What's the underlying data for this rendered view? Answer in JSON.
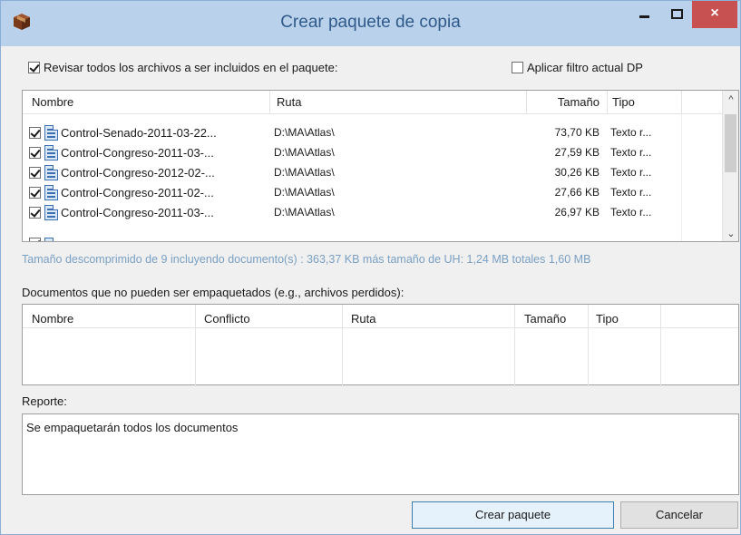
{
  "window": {
    "title": "Crear paquete de copia",
    "close_glyph": "×"
  },
  "options": {
    "review_all_label": "Revisar todos los archivos a ser incluidos en el paquete:",
    "review_all_checked": true,
    "apply_filter_label": "Aplicar filtro actual DP",
    "apply_filter_checked": false
  },
  "files_table": {
    "columns": [
      "Nombre",
      "Ruta",
      "Tamaño",
      "Tipo"
    ],
    "rows": [
      {
        "name": "Control-Senado-2011-03-22...",
        "path": "D:\\MA\\Atlas\\",
        "size": "73,70 KB",
        "type": "Texto r...",
        "checked": true
      },
      {
        "name": "Control-Congreso-2011-03-...",
        "path": "D:\\MA\\Atlas\\",
        "size": "27,59 KB",
        "type": "Texto r...",
        "checked": true
      },
      {
        "name": "Control-Congreso-2012-02-...",
        "path": "D:\\MA\\Atlas\\",
        "size": "30,26 KB",
        "type": "Texto r...",
        "checked": true
      },
      {
        "name": "Control-Congreso-2011-02-...",
        "path": "D:\\MA\\Atlas\\",
        "size": "27,66 KB",
        "type": "Texto r...",
        "checked": true
      },
      {
        "name": "Control-Congreso-2011-03-...",
        "path": "D:\\MA\\Atlas\\",
        "size": "26,97 KB",
        "type": "Texto r...",
        "checked": true
      }
    ],
    "scroll_up_glyph": "^",
    "scroll_down_glyph": "⌄"
  },
  "summary": "Tamaño descomprimido de 9 incluyendo documento(s) : 363,37 KB más tamaño de UH: 1,24 MB totales 1,60 MB",
  "unpackable": {
    "label": "Documentos que no pueden ser empaquetados (e.g., archivos perdidos):",
    "columns": [
      "Nombre",
      "Conflicto",
      "Ruta",
      "Tamaño",
      "Tipo"
    ]
  },
  "report": {
    "label": "Reporte:",
    "text": "Se empaquetarán todos los documentos"
  },
  "buttons": {
    "create": "Crear paquete",
    "cancel": "Cancelar"
  },
  "colors": {
    "titlebar": "#b9d1ea",
    "title_text": "#2f5a8a",
    "close_button": "#c75050",
    "summary_text": "#7aa0c4"
  },
  "icons": {
    "app": "package-icon",
    "file": "rtf-document-icon"
  }
}
